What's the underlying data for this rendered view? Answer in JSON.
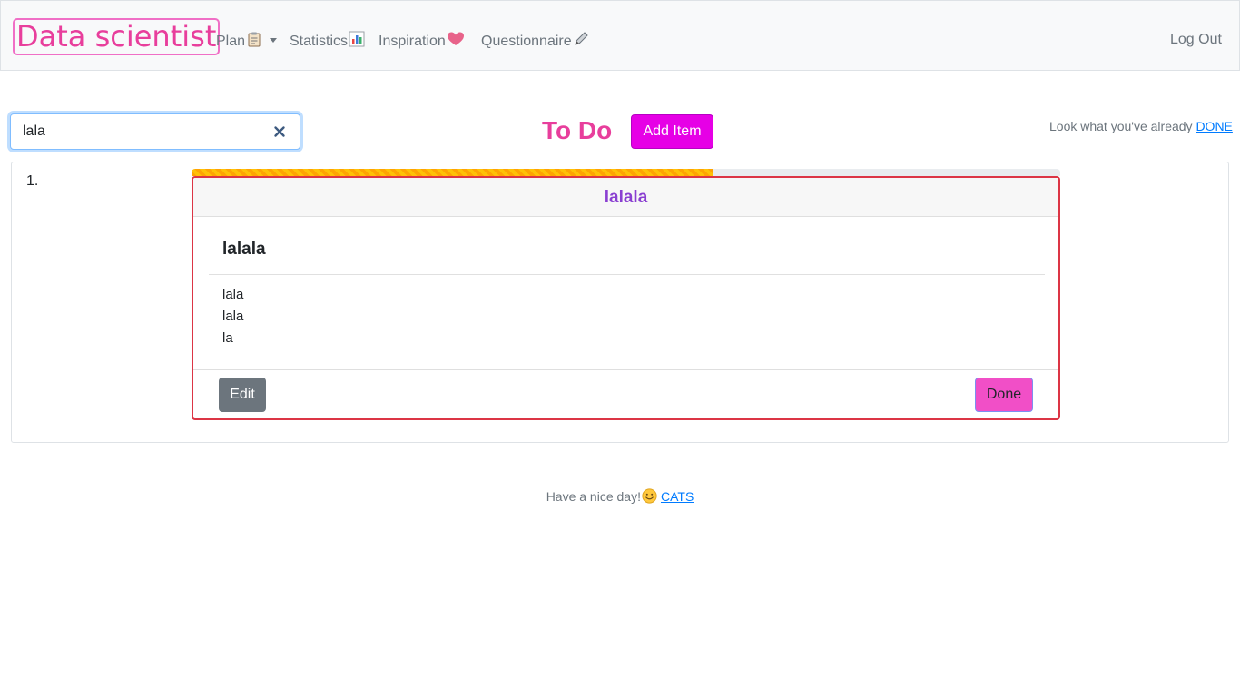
{
  "navbar": {
    "brand": "Data scientist",
    "links": [
      {
        "label": "Plan",
        "icon": "clipboard-icon",
        "has_dropdown": true
      },
      {
        "label": "Statistics",
        "icon": "bar-chart-icon"
      },
      {
        "label": "Inspiration",
        "icon": "heart-icon"
      },
      {
        "label": "Questionnaire",
        "icon": "pencil-icon"
      }
    ],
    "logout": "Log Out"
  },
  "search": {
    "value": "lala",
    "clear_icon": "close-icon"
  },
  "todo": {
    "title": "To Do",
    "add_button": "Add Item",
    "done_prefix": "Look what you've already ",
    "done_link": "DONE"
  },
  "items": [
    {
      "number": "1.",
      "progress": 0.6,
      "header": "lalala",
      "title": "lalala",
      "lines": [
        "lala",
        "lala",
        "la"
      ],
      "edit_label": "Edit",
      "done_label": "Done"
    }
  ],
  "footer": {
    "text": "Have a nice day!",
    "icon": "smile-icon",
    "link": "CATS"
  },
  "colors": {
    "brand": "#e83e9c",
    "add_button": "#e600e6",
    "card_border": "#dc3545",
    "done_button": "#f14fc7",
    "header_text": "#8a3fd1",
    "progress": "#ffc107"
  }
}
